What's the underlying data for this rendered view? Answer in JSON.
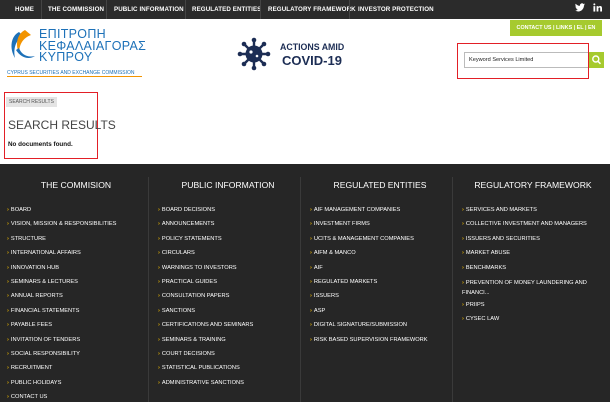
{
  "top_nav": [
    "HOME",
    "THE COMMISSION",
    "PUBLIC INFORMATION",
    "REGULATED ENTITIES",
    "REGULATORY FRAMEWORK",
    "INVESTOR PROTECTION"
  ],
  "social_icons": [
    "twitter-icon",
    "linkedin-icon"
  ],
  "util_bar": "CONTACT US  |  LINKS  |  EL | EN",
  "logo": {
    "line1": "ΕΠΙΤΡΟΠΗ",
    "line2": "ΚΕΦΑΛΑΙΑΓΟΡΑΣ",
    "line3": "ΚΥΠΡΟΥ",
    "sub": "CYPRUS SECURITIES AND EXCHANGE COMMISSION"
  },
  "covid": {
    "line1": "ACTIONS AMID",
    "line2": "COVID-19"
  },
  "search": {
    "value": "Keyword Services Limited",
    "button_icon": "search-icon"
  },
  "results": {
    "breadcrumb": "SEARCH RESULTS",
    "title": "SEARCH RESULTS",
    "message": "No documents found."
  },
  "footer": {
    "columns": [
      {
        "heading": "THE COMMISION",
        "links": [
          "BOARD",
          "VISION, MISSION & RESPONSIBILITIES",
          "STRUCTURE",
          "INTERNATIONAL AFFAIRS",
          "INNOVATION HUB",
          "SEMINARS & LECTURES",
          "ANNUAL REPORTS",
          "FINANCIAL STATEMENTS",
          "PAYABLE FEES",
          "INVITATION OF TENDERS",
          "SOCIAL RESPONSIBILITY",
          "RECRUITMENT",
          "PUBLIC HOLIDAYS",
          "CONTACT US"
        ]
      },
      {
        "heading": "PUBLIC INFORMATION",
        "links": [
          "BOARD DECISIONS",
          "ANNOUNCEMENTS",
          "POLICY STATEMENTS",
          "CIRCULARS",
          "WARNINGS TO INVESTORS",
          "PRACTICAL GUIDES",
          "CONSULTATION PAPERS",
          "SANCTIONS",
          "CERTIFICATIONS AND SEMINARS",
          "SEMINARS & TRAINING",
          "COURT DECISIONS",
          "STATISTICAL PUBLICATIONS",
          "ADMINISTRATIVE SANCTIONS"
        ]
      },
      {
        "heading": "REGULATED ENTITIES",
        "links": [
          "AIF MANAGEMENT COMPANIES",
          "INVESTMENT FIRMS",
          "UCITS & MANAGEMENT COMPANIES",
          "AIFM & MANCO",
          "AIF",
          "REGULATED MARKETS",
          "ISSUERS",
          "ASP",
          "DIGITAL SIGNATURE/SUBMISSION",
          "RISK BASED SUPERVISION FRAMEWORK"
        ]
      },
      {
        "heading": "REGULATORY FRAMEWORK",
        "links": [
          "SERVICES AND MARKETS",
          "COLLECTIVE INVESTMENT AND MANAGERS",
          "ISSUERS AND SECURITIES",
          "MARKET ABUSE",
          "BENCHMARKS",
          "PREVENTION OF MONEY LAUNDERING AND FINANCI...",
          "PRIIPS",
          "CYSEC LAW"
        ]
      }
    ]
  }
}
